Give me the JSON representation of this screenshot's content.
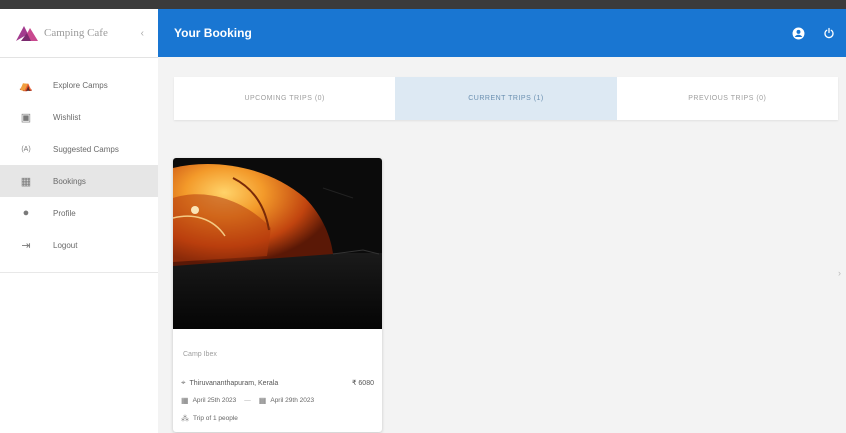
{
  "app": {
    "brand": "Camping Cafe",
    "caret": "‹"
  },
  "sidebar": {
    "items": [
      {
        "label": "Explore Camps",
        "icon": "tent-icon",
        "glyph": "⛺"
      },
      {
        "label": "Wishlist",
        "icon": "heart-box-icon",
        "glyph": "▣"
      },
      {
        "label": "Suggested Camps",
        "icon": "suggested-icon",
        "glyph": "(A)"
      },
      {
        "label": "Bookings",
        "icon": "calendar-icon",
        "glyph": "▦",
        "active": true
      },
      {
        "label": "Profile",
        "icon": "account-icon",
        "glyph": "●"
      },
      {
        "label": "Logout",
        "icon": "logout-icon",
        "glyph": "⇥"
      }
    ]
  },
  "header": {
    "title": "Your Booking",
    "icons": [
      "account-circle-icon",
      "power-icon"
    ],
    "color": "#1976d2"
  },
  "tabs": [
    {
      "label": "UPCOMING TRIPS (0)"
    },
    {
      "label": "CURRENT TRIPS (1)",
      "active": true
    },
    {
      "label": "PREVIOUS TRIPS (0)"
    }
  ],
  "booking": {
    "camp_name": "Camp Ibex",
    "location": "Thiruvananthapuram, Kerala",
    "price": "₹ 6080",
    "start_date": "April 25th 2023",
    "end_date": "April 29th 2023",
    "dash": "—",
    "trip": "Trip of 1 people"
  }
}
